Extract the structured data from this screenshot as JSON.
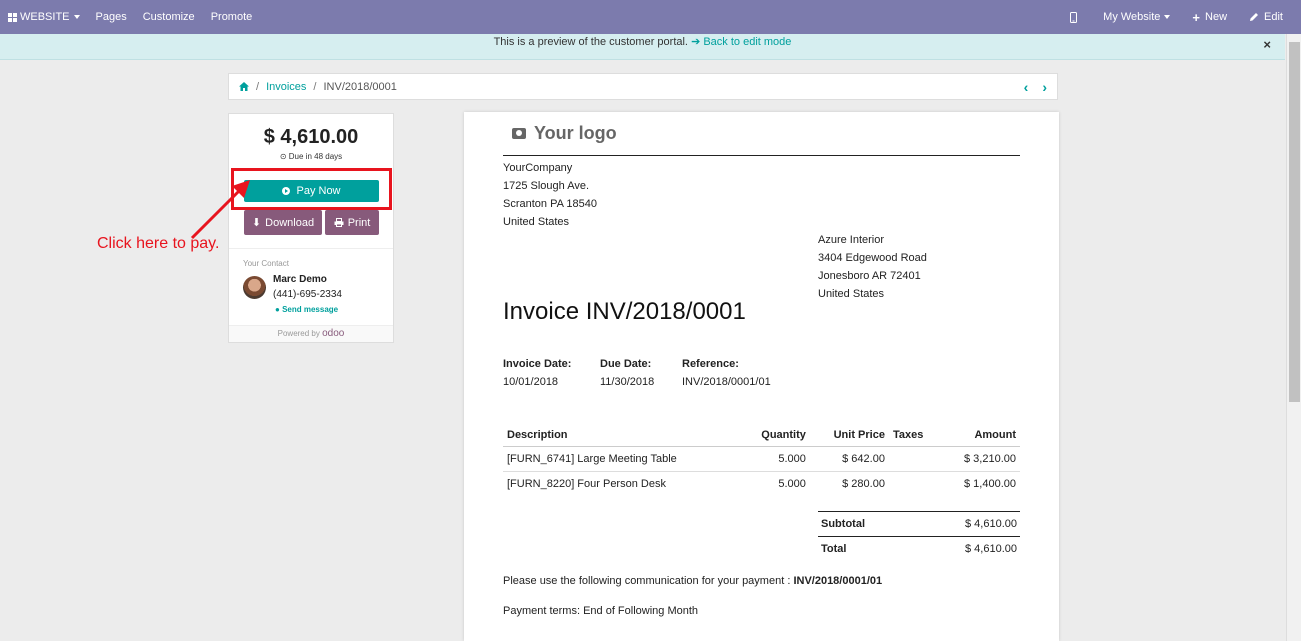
{
  "topbar": {
    "website_label": "WEBSITE",
    "pages_label": "Pages",
    "customize_label": "Customize",
    "promote_label": "Promote",
    "my_website_label": "My Website",
    "new_label": "New",
    "edit_label": "Edit",
    "bg_color": "#7c7bad"
  },
  "banner": {
    "text": "This is a preview of the customer portal.",
    "link": "Back to edit mode",
    "close": "×"
  },
  "breadcrumb": {
    "home_icon": "home-icon",
    "invoices": "Invoices",
    "current": "INV/2018/0001",
    "sep": "/"
  },
  "sidebar": {
    "amount": "$ 4,610.00",
    "due": "Due in 48 days",
    "pay_now": "Pay Now",
    "download": "Download",
    "print": "Print",
    "contact_label": "Your Contact",
    "contact_name": "Marc Demo",
    "contact_phone": "(441)-695-2334",
    "send_message": "Send message",
    "powered_by": "Powered by",
    "powered_brand": "odoo"
  },
  "annotation": {
    "text": "Click here to pay.",
    "color": "#e8141e"
  },
  "invoice": {
    "logo_text": "Your logo",
    "company_address": [
      "YourCompany",
      "1725 Slough Ave.",
      "Scranton PA 18540",
      "United States"
    ],
    "customer_address": [
      "Azure Interior",
      "3404 Edgewood Road",
      "Jonesboro AR 72401",
      "United States"
    ],
    "title": "Invoice INV/2018/0001",
    "meta": [
      {
        "label": "Invoice Date:",
        "value": "10/01/2018"
      },
      {
        "label": "Due Date:",
        "value": "11/30/2018"
      },
      {
        "label": "Reference:",
        "value": "INV/2018/0001/01"
      }
    ],
    "columns": [
      "Description",
      "Quantity",
      "Unit Price",
      "Taxes",
      "Amount"
    ],
    "lines": [
      {
        "description": "[FURN_6741] Large Meeting Table",
        "quantity": "5.000",
        "unit_price": "$ 642.00",
        "taxes": "",
        "amount": "$ 3,210.00"
      },
      {
        "description": "[FURN_8220] Four Person Desk",
        "quantity": "5.000",
        "unit_price": "$ 280.00",
        "taxes": "",
        "amount": "$ 1,400.00"
      }
    ],
    "subtotal_label": "Subtotal",
    "subtotal_value": "$ 4,610.00",
    "total_label": "Total",
    "total_value": "$ 4,610.00",
    "communication_text": "Please use the following communication for your payment :",
    "communication_ref": "INV/2018/0001/01",
    "payment_terms": "Payment terms: End of Following Month"
  },
  "colors": {
    "accent": "#00a09d",
    "secondary": "#875a7b"
  }
}
